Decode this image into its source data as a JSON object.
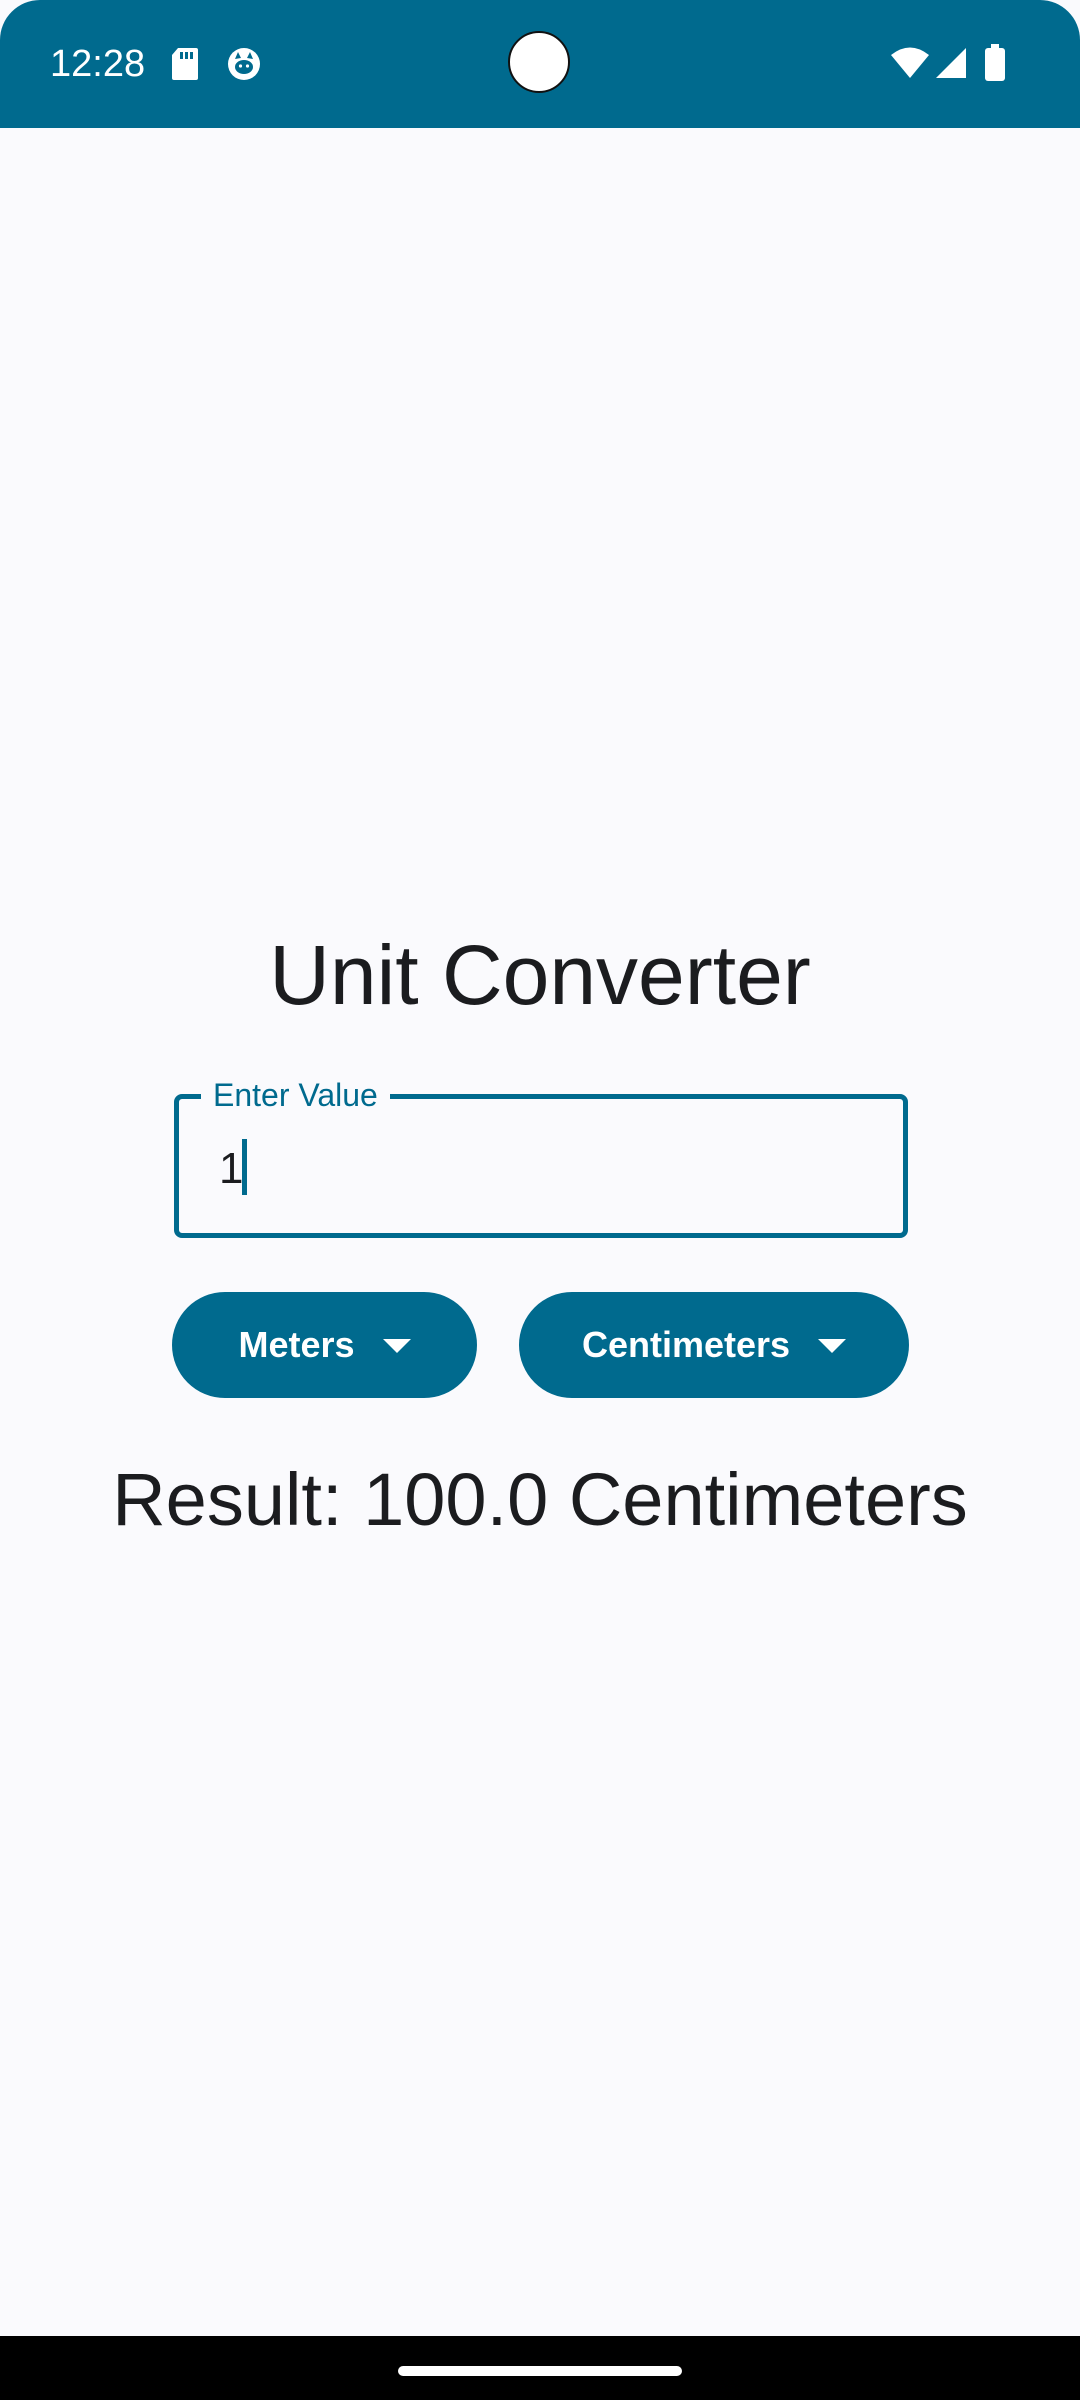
{
  "status_bar": {
    "time": "12:28",
    "left_icons": [
      "sd-card-icon",
      "cat-icon"
    ],
    "right_icons": [
      "wifi-icon",
      "signal-icon",
      "battery-icon"
    ],
    "color": "#006A8E"
  },
  "app": {
    "title": "Unit Converter",
    "input": {
      "label": "Enter Value",
      "value": "1"
    },
    "from_unit": {
      "label": "Meters"
    },
    "to_unit": {
      "label": "Centimeters"
    },
    "result": "Result: 100.0 Centimeters"
  },
  "colors": {
    "primary": "#006A8E",
    "background": "#FAFAFD",
    "text": "#1B1C1F"
  }
}
